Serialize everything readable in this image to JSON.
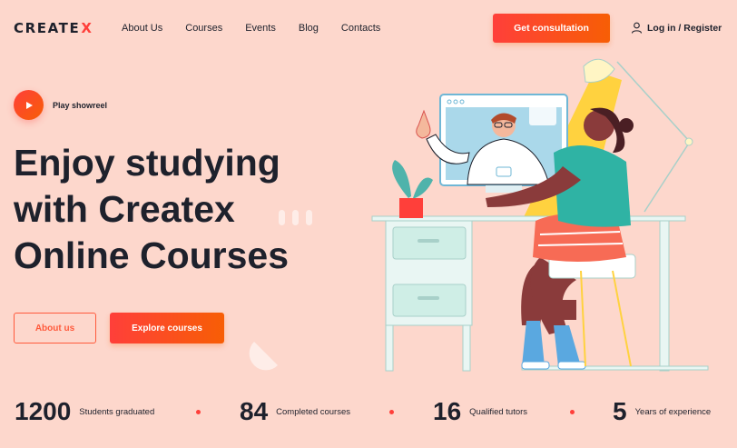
{
  "header": {
    "logo_text": "CREATE",
    "logo_mark": "X",
    "nav": [
      "About Us",
      "Courses",
      "Events",
      "Blog",
      "Contacts"
    ],
    "cta_label": "Get consultation",
    "login_label": "Log in / Register",
    "login_icon": "person-icon"
  },
  "hero": {
    "play_label": "Play showreel",
    "play_icon": "play-icon",
    "title_lines": [
      "Enjoy studying",
      "with Createx",
      "Online Courses"
    ],
    "about_button": "About us",
    "explore_button": "Explore courses"
  },
  "stats": [
    {
      "number": "1200",
      "label": "Students graduated"
    },
    {
      "number": "84",
      "label": "Completed courses"
    },
    {
      "number": "16",
      "label": "Qualified tutors"
    },
    {
      "number": "5",
      "label": "Years of experience"
    }
  ],
  "colors": {
    "background": "#fdd7cc",
    "accent_start": "#ff3f3a",
    "accent_end": "#f75e05",
    "text": "#1e212c"
  }
}
